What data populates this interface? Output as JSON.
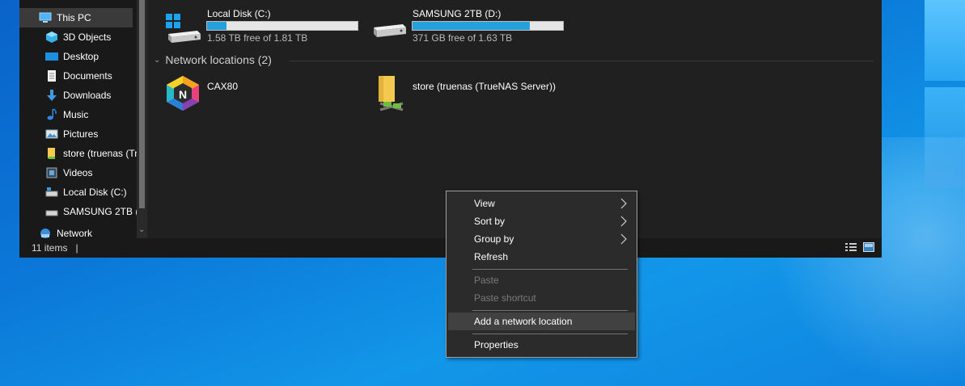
{
  "nav": {
    "items": [
      {
        "label": "This PC",
        "icon": "computer-icon",
        "selected": true
      },
      {
        "label": "3D Objects",
        "icon": "cube-icon"
      },
      {
        "label": "Desktop",
        "icon": "desktop-icon"
      },
      {
        "label": "Documents",
        "icon": "document-icon"
      },
      {
        "label": "Downloads",
        "icon": "download-icon"
      },
      {
        "label": "Music",
        "icon": "music-icon"
      },
      {
        "label": "Pictures",
        "icon": "pictures-icon"
      },
      {
        "label": "store (truenas (Tr",
        "icon": "folder-icon"
      },
      {
        "label": "Videos",
        "icon": "videos-icon"
      },
      {
        "label": "Local Disk (C:)",
        "icon": "drive-icon"
      },
      {
        "label": "SAMSUNG 2TB (",
        "icon": "drive-icon"
      },
      {
        "label": "Network",
        "icon": "network-icon"
      }
    ]
  },
  "drives": [
    {
      "name": "Local Disk (C:)",
      "free": "1.58 TB free of 1.81 TB",
      "used_fraction": 0.13
    },
    {
      "name": "SAMSUNG 2TB (D:)",
      "free": "371 GB free of 1.63 TB",
      "used_fraction": 0.78
    }
  ],
  "network_group": {
    "header": "Network locations (2)",
    "items": [
      {
        "name": "CAX80",
        "icon": "router-hex-icon"
      },
      {
        "name": "store (truenas (TrueNAS Server))",
        "icon": "network-folder-icon"
      }
    ]
  },
  "status": {
    "count": "11 items"
  },
  "context_menu": {
    "items": [
      {
        "label": "View",
        "submenu": true
      },
      {
        "label": "Sort by",
        "submenu": true
      },
      {
        "label": "Group by",
        "submenu": true
      },
      {
        "label": "Refresh"
      },
      {
        "label": "Paste",
        "disabled": true
      },
      {
        "label": "Paste shortcut",
        "disabled": true
      },
      {
        "label": "Add a network location",
        "highlighted": true
      },
      {
        "label": "Properties"
      }
    ]
  },
  "colors": {
    "accent": "#26a0da",
    "desktop": "#0b78d8"
  }
}
